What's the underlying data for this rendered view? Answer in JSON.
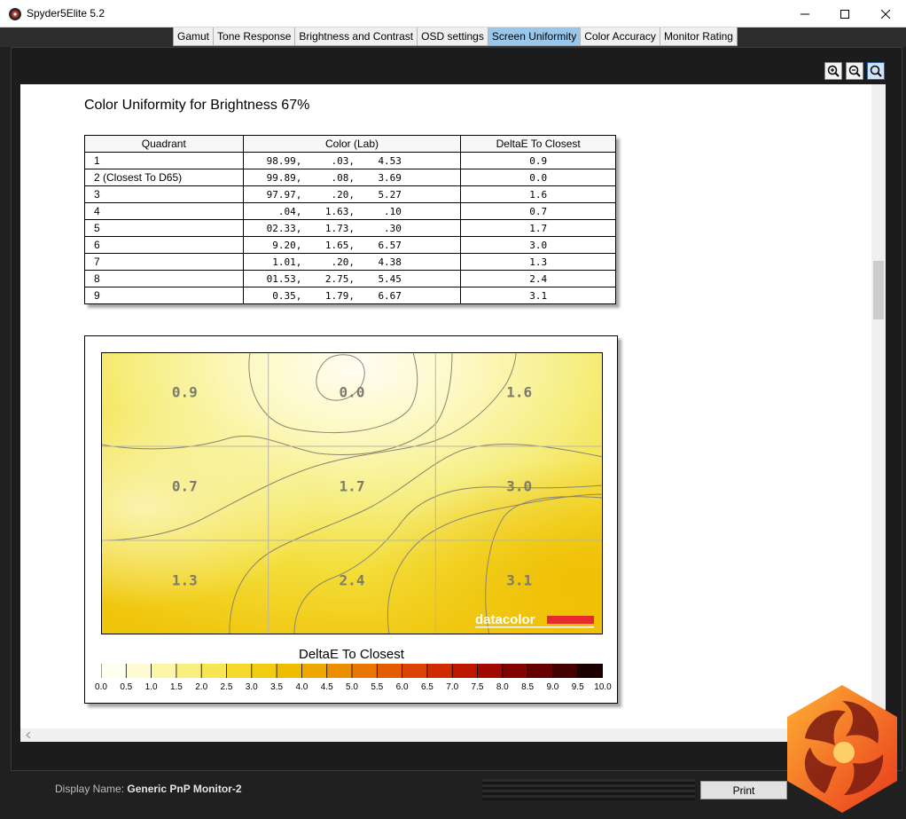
{
  "window": {
    "title": "Spyder5Elite 5.2"
  },
  "tabs": [
    {
      "label": "Gamut",
      "active": false
    },
    {
      "label": "Tone Response",
      "active": false
    },
    {
      "label": "Brightness and Contrast",
      "active": false
    },
    {
      "label": "OSD settings",
      "active": false
    },
    {
      "label": "Screen Uniformity",
      "active": true
    },
    {
      "label": "Color Accuracy",
      "active": false
    },
    {
      "label": "Monitor Rating",
      "active": false
    }
  ],
  "zoom": {
    "icons": [
      "zoom-in-icon",
      "zoom-out-icon",
      "zoom-fit-icon"
    ]
  },
  "report": {
    "title": "Color Uniformity for Brightness 67%",
    "table": {
      "headers": [
        "Quadrant",
        "Color (Lab)",
        "DeltaE To Closest"
      ],
      "rows": [
        {
          "quadrant": "1",
          "lab": "98.99,     .03,    4.53",
          "delta": "0.9"
        },
        {
          "quadrant": "2 (Closest To D65)",
          "lab": "99.89,     .08,    3.69",
          "delta": "0.0"
        },
        {
          "quadrant": "3",
          "lab": "97.97,     .20,    5.27",
          "delta": "1.6"
        },
        {
          "quadrant": "4",
          "lab": "  .04,    1.63,     .10",
          "delta": "0.7"
        },
        {
          "quadrant": "5",
          "lab": "02.33,    1.73,     .30",
          "delta": "1.7"
        },
        {
          "quadrant": "6",
          "lab": " 9.20,    1.65,    6.57",
          "delta": "3.0"
        },
        {
          "quadrant": "7",
          "lab": " 1.01,     .20,    4.38",
          "delta": "1.3"
        },
        {
          "quadrant": "8",
          "lab": "01.53,    2.75,    5.45",
          "delta": "2.4"
        },
        {
          "quadrant": "9",
          "lab": " 0.35,    1.79,    6.67",
          "delta": "3.1"
        }
      ]
    },
    "heatmap": {
      "cells": [
        "0.9",
        "0.0",
        "1.6",
        "0.7",
        "1.7",
        "3.0",
        "1.3",
        "2.4",
        "3.1"
      ],
      "logo_text": "datacolor"
    },
    "legend": {
      "title": "DeltaE To Closest",
      "ticks": [
        "0.0",
        "0.5",
        "1.0",
        "1.5",
        "2.0",
        "2.5",
        "3.0",
        "3.5",
        "4.0",
        "4.5",
        "5.0",
        "5.5",
        "6.0",
        "6.5",
        "7.0",
        "7.5",
        "8.0",
        "8.5",
        "9.0",
        "9.5",
        "10.0"
      ]
    }
  },
  "chart_data": {
    "type": "heatmap",
    "title": "",
    "grid": {
      "rows": 3,
      "cols": 3
    },
    "values": [
      [
        0.9,
        0.0,
        1.6
      ],
      [
        0.7,
        1.7,
        3.0
      ],
      [
        1.3,
        2.4,
        3.1
      ]
    ],
    "colorbar": {
      "label": "DeltaE To Closest",
      "range": [
        0,
        10
      ],
      "step": 0.5
    }
  },
  "footer": {
    "display_label": "Display Name:",
    "display_value": "Generic PnP Monitor-2",
    "print_label": "Print"
  },
  "colors": {
    "active_tab": "#99c7ec",
    "accent_red": "#e52b2b"
  }
}
